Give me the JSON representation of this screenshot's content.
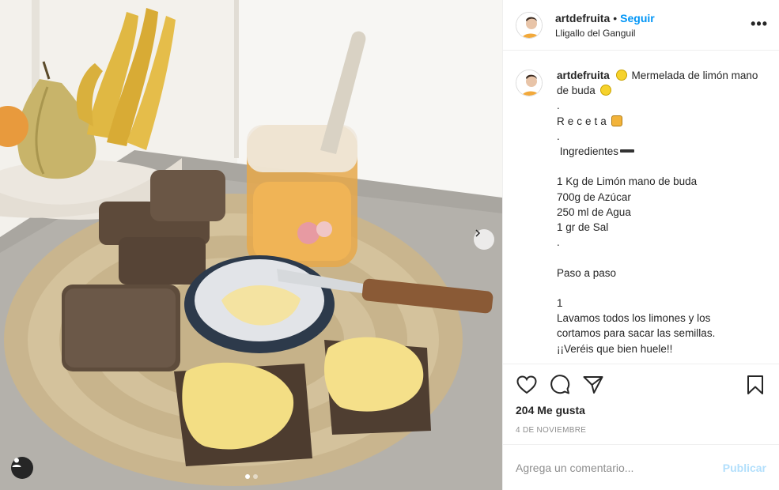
{
  "header": {
    "username": "artdefruita",
    "separator": "•",
    "follow_label": "Seguir",
    "location": "Lligallo del Ganguil",
    "more_label": "•••"
  },
  "caption": {
    "username": "artdefruita",
    "title_text": "Mermelada de limón mano de buda",
    "lines": [
      ".",
      "Receta",
      ".",
      " Ingredientes",
      "",
      "1 Kg de Limón mano de buda",
      "700g de Azúcar",
      "250 ml de Agua",
      "1 gr de Sal",
      ".",
      "",
      "Paso a paso",
      "",
      "1",
      "Lavamos todos los limones y los",
      "cortamos para sacar las semillas.",
      "¡¡Veréis que bien huele!!"
    ]
  },
  "actions": {
    "icons": [
      "heart-icon",
      "comment-icon",
      "share-icon",
      "bookmark-icon"
    ],
    "likes": "204 Me gusta",
    "date": "4 DE NOVIEMBRE"
  },
  "comment": {
    "placeholder": "Agrega un comentario...",
    "publish_label": "Publicar"
  },
  "colors": {
    "accent": "#0095f6",
    "publish_disabled": "#b2dffc",
    "text": "#262626",
    "muted": "#8e8e8e"
  }
}
